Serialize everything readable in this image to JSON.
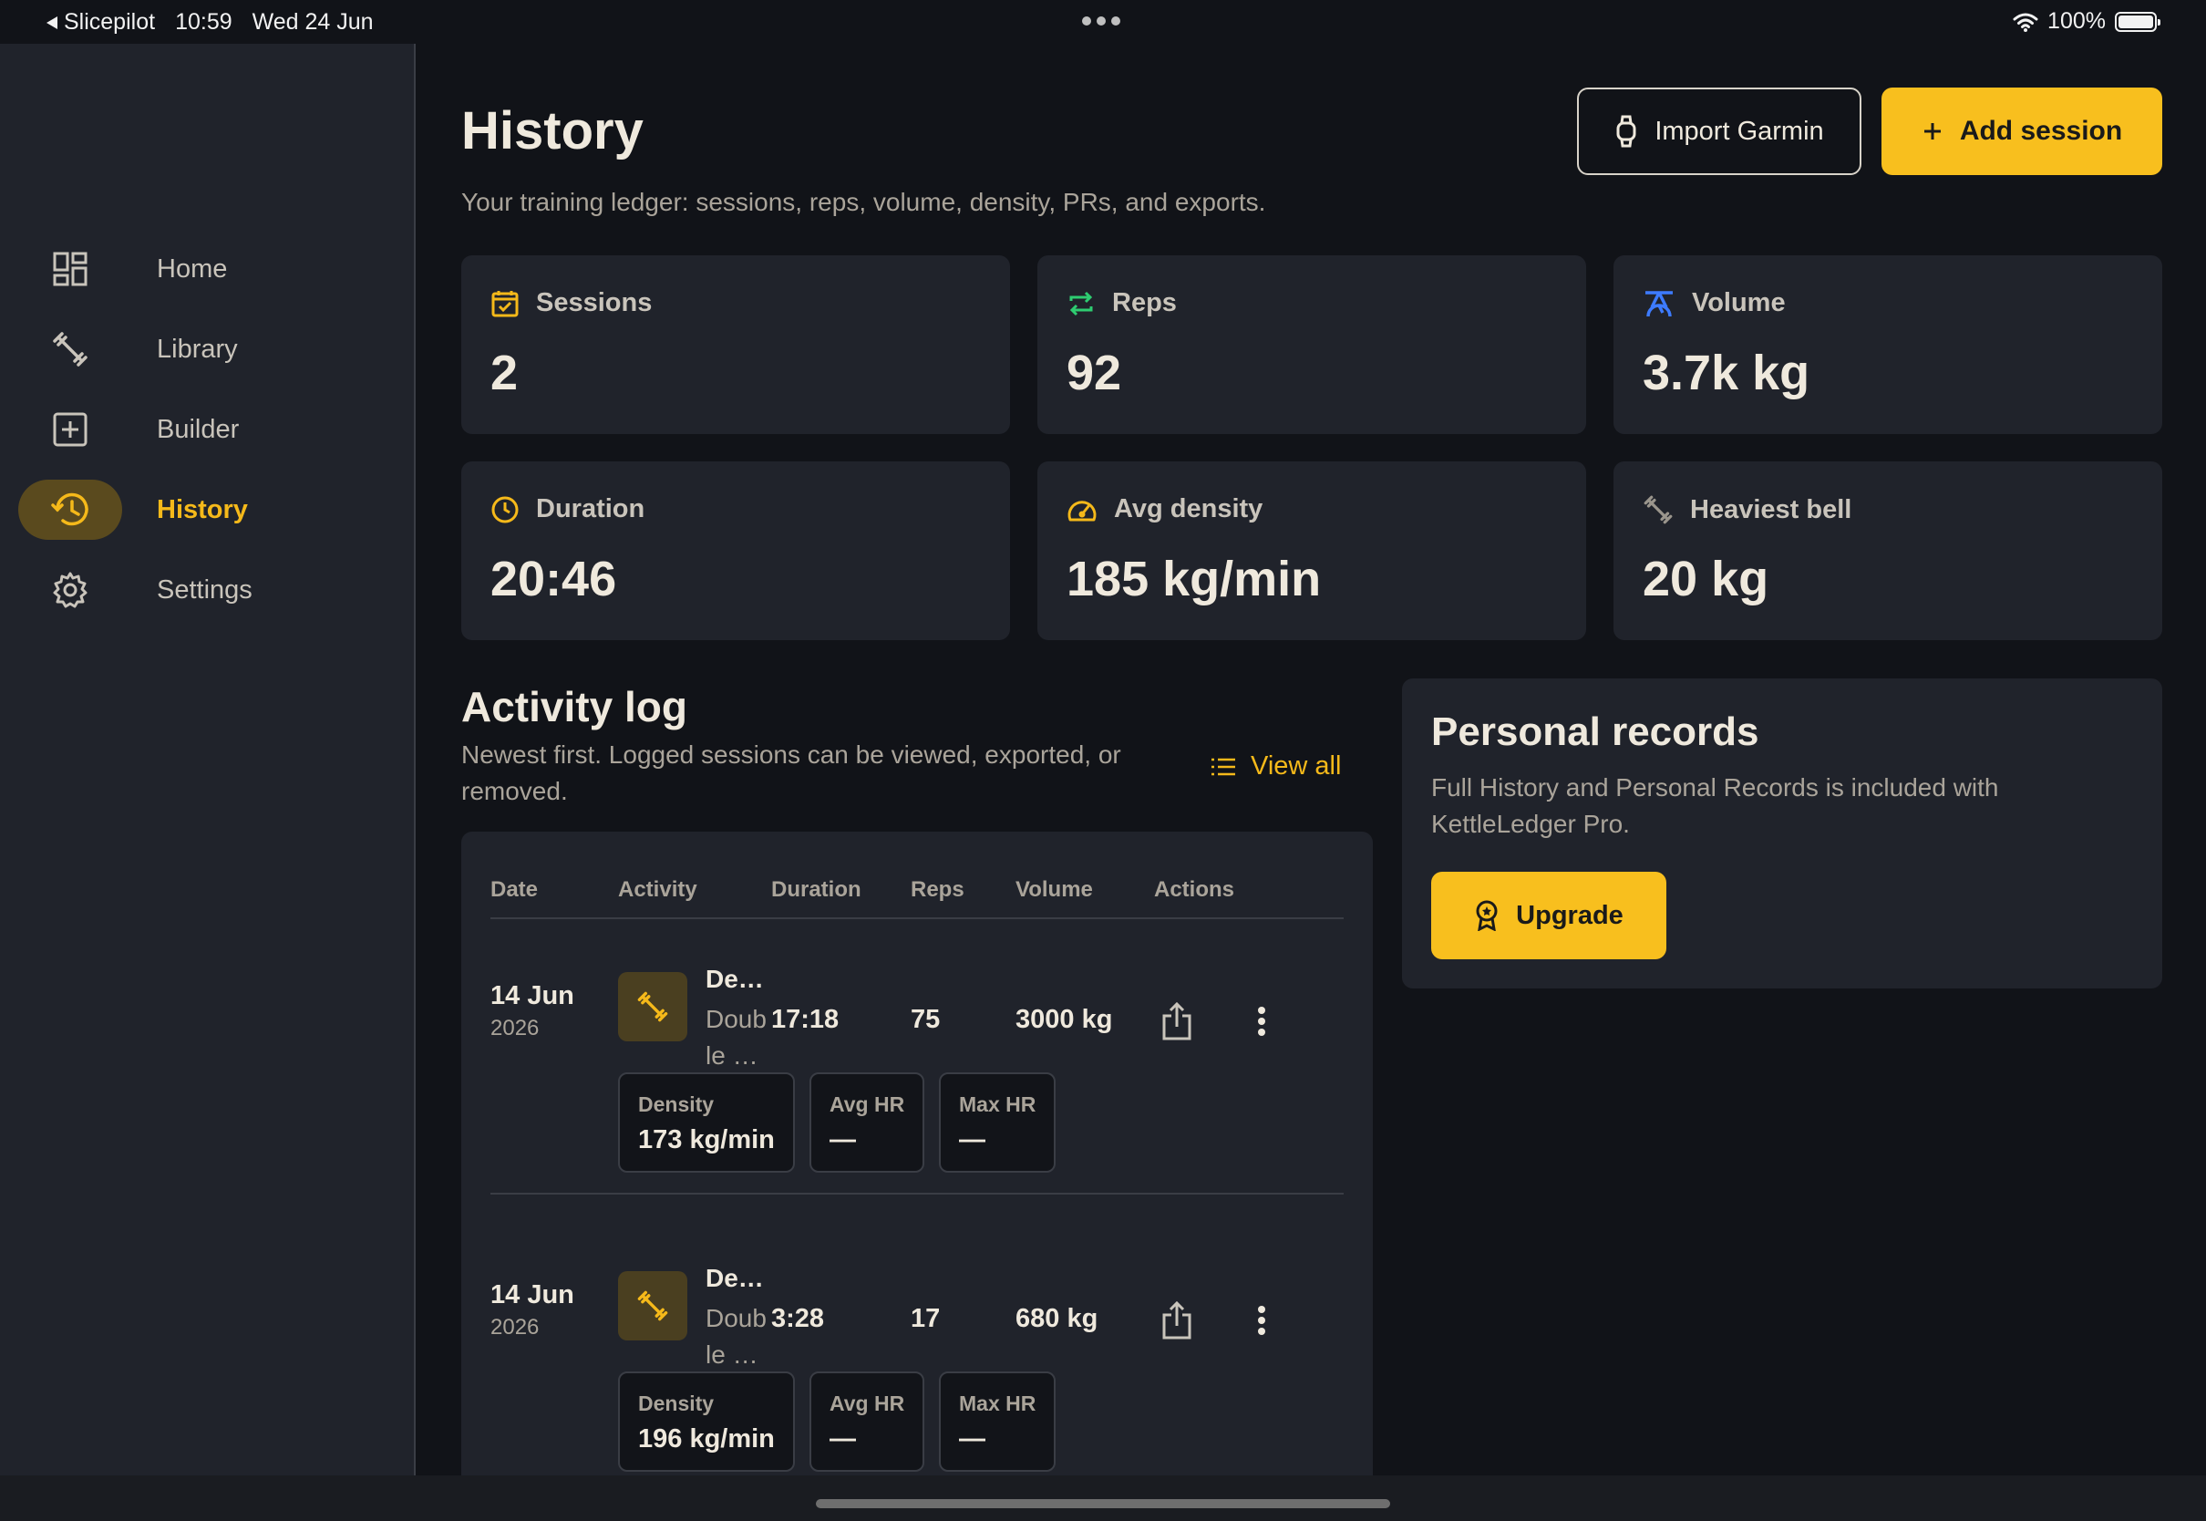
{
  "status_bar": {
    "back_app": "Slicepilot",
    "time": "10:59",
    "date": "Wed 24 Jun",
    "battery": "100%"
  },
  "sidebar": {
    "items": [
      {
        "label": "Home",
        "icon": "dashboard-icon"
      },
      {
        "label": "Library",
        "icon": "kettlebell-icon"
      },
      {
        "label": "Builder",
        "icon": "add-box-icon"
      },
      {
        "label": "History",
        "icon": "history-icon",
        "active": true
      },
      {
        "label": "Settings",
        "icon": "gear-icon"
      }
    ]
  },
  "header": {
    "title": "History",
    "subtitle": "Your training ledger: sessions, reps, volume, density, PRs, and exports.",
    "import_label": "Import Garmin",
    "add_label": "Add session"
  },
  "stats": [
    {
      "label": "Sessions",
      "value": "2",
      "icon": "calendar-check-icon",
      "color": "#f5b91a"
    },
    {
      "label": "Reps",
      "value": "92",
      "icon": "repeat-icon",
      "color": "#2ecc71"
    },
    {
      "label": "Volume",
      "value": "3.7k kg",
      "icon": "scale-icon",
      "color": "#3d7bff"
    },
    {
      "label": "Duration",
      "value": "20:46",
      "icon": "clock-icon",
      "color": "#f5b91a"
    },
    {
      "label": "Avg density",
      "value": "185 kg/min",
      "icon": "speedometer-icon",
      "color": "#f5b91a"
    },
    {
      "label": "Heaviest bell",
      "value": "20 kg",
      "icon": "dumbbell-icon",
      "color": "#9a958c"
    }
  ],
  "activity_log": {
    "title": "Activity log",
    "description": "Newest first. Logged sessions can be viewed, exported, or removed.",
    "view_all": "View all",
    "columns": [
      "Date",
      "Activity",
      "Duration",
      "Reps",
      "Volume",
      "Actions"
    ],
    "rows": [
      {
        "date": "14 Jun",
        "year": "2026",
        "name": "De…",
        "sub": "Double …",
        "duration": "17:18",
        "reps": "75",
        "volume": "3000 kg",
        "density_label": "Density",
        "density": "173 kg/min",
        "avg_hr_label": "Avg HR",
        "avg_hr": "—",
        "max_hr_label": "Max HR",
        "max_hr": "—"
      },
      {
        "date": "14 Jun",
        "year": "2026",
        "name": "De…",
        "sub": "Double …",
        "duration": "3:28",
        "reps": "17",
        "volume": "680 kg",
        "density_label": "Density",
        "density": "196 kg/min",
        "avg_hr_label": "Avg HR",
        "avg_hr": "—",
        "max_hr_label": "Max HR",
        "max_hr": "—"
      }
    ]
  },
  "personal_records": {
    "title": "Personal records",
    "description": "Full History and Personal Records is included with KettleLedger Pro.",
    "upgrade_label": "Upgrade"
  },
  "colors": {
    "accent": "#f8bf1e",
    "background": "#111318",
    "card": "#20232b"
  }
}
